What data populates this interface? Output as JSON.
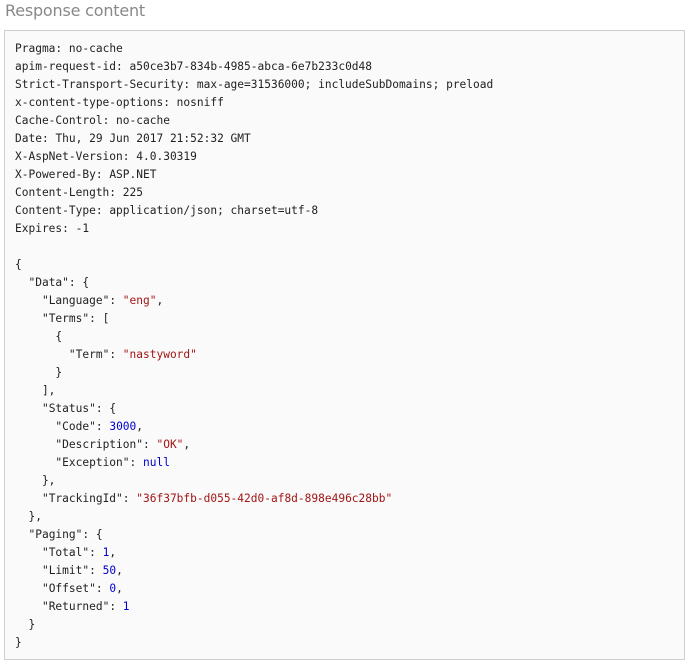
{
  "section": {
    "title": "Response content"
  },
  "response": {
    "headers": [
      {
        "name": "Pragma",
        "value": "no-cache"
      },
      {
        "name": "apim-request-id",
        "value": "a50ce3b7-834b-4985-abca-6e7b233c0d48"
      },
      {
        "name": "Strict-Transport-Security",
        "value": "max-age=31536000; includeSubDomains; preload"
      },
      {
        "name": "x-content-type-options",
        "value": "nosniff"
      },
      {
        "name": "Cache-Control",
        "value": "no-cache"
      },
      {
        "name": "Date",
        "value": "Thu, 29 Jun 2017 21:52:32 GMT"
      },
      {
        "name": "X-AspNet-Version",
        "value": "4.0.30319"
      },
      {
        "name": "X-Powered-By",
        "value": "ASP.NET"
      },
      {
        "name": "Content-Length",
        "value": "225"
      },
      {
        "name": "Content-Type",
        "value": "application/json; charset=utf-8"
      },
      {
        "name": "Expires",
        "value": "-1"
      }
    ],
    "body_lines": [
      [
        {
          "t": "p",
          "v": "{"
        }
      ],
      [
        {
          "t": "p",
          "v": "  "
        },
        {
          "t": "k",
          "v": "\"Data\""
        },
        {
          "t": "p",
          "v": ": {"
        }
      ],
      [
        {
          "t": "p",
          "v": "    "
        },
        {
          "t": "k",
          "v": "\"Language\""
        },
        {
          "t": "p",
          "v": ": "
        },
        {
          "t": "s",
          "v": "\"eng\""
        },
        {
          "t": "p",
          "v": ","
        }
      ],
      [
        {
          "t": "p",
          "v": "    "
        },
        {
          "t": "k",
          "v": "\"Terms\""
        },
        {
          "t": "p",
          "v": ": ["
        }
      ],
      [
        {
          "t": "p",
          "v": "      {"
        }
      ],
      [
        {
          "t": "p",
          "v": "        "
        },
        {
          "t": "k",
          "v": "\"Term\""
        },
        {
          "t": "p",
          "v": ": "
        },
        {
          "t": "s",
          "v": "\"nastyword\""
        }
      ],
      [
        {
          "t": "p",
          "v": "      }"
        }
      ],
      [
        {
          "t": "p",
          "v": "    ],"
        }
      ],
      [
        {
          "t": "p",
          "v": "    "
        },
        {
          "t": "k",
          "v": "\"Status\""
        },
        {
          "t": "p",
          "v": ": {"
        }
      ],
      [
        {
          "t": "p",
          "v": "      "
        },
        {
          "t": "k",
          "v": "\"Code\""
        },
        {
          "t": "p",
          "v": ": "
        },
        {
          "t": "n",
          "v": "3000"
        },
        {
          "t": "p",
          "v": ","
        }
      ],
      [
        {
          "t": "p",
          "v": "      "
        },
        {
          "t": "k",
          "v": "\"Description\""
        },
        {
          "t": "p",
          "v": ": "
        },
        {
          "t": "s",
          "v": "\"OK\""
        },
        {
          "t": "p",
          "v": ","
        }
      ],
      [
        {
          "t": "p",
          "v": "      "
        },
        {
          "t": "k",
          "v": "\"Exception\""
        },
        {
          "t": "p",
          "v": ": "
        },
        {
          "t": "nl",
          "v": "null"
        }
      ],
      [
        {
          "t": "p",
          "v": "    },"
        }
      ],
      [
        {
          "t": "p",
          "v": "    "
        },
        {
          "t": "k",
          "v": "\"TrackingId\""
        },
        {
          "t": "p",
          "v": ": "
        },
        {
          "t": "s",
          "v": "\"36f37bfb-d055-42d0-af8d-898e496c28bb\""
        }
      ],
      [
        {
          "t": "p",
          "v": "  },"
        }
      ],
      [
        {
          "t": "p",
          "v": "  "
        },
        {
          "t": "k",
          "v": "\"Paging\""
        },
        {
          "t": "p",
          "v": ": {"
        }
      ],
      [
        {
          "t": "p",
          "v": "    "
        },
        {
          "t": "k",
          "v": "\"Total\""
        },
        {
          "t": "p",
          "v": ": "
        },
        {
          "t": "n",
          "v": "1"
        },
        {
          "t": "p",
          "v": ","
        }
      ],
      [
        {
          "t": "p",
          "v": "    "
        },
        {
          "t": "k",
          "v": "\"Limit\""
        },
        {
          "t": "p",
          "v": ": "
        },
        {
          "t": "n",
          "v": "50"
        },
        {
          "t": "p",
          "v": ","
        }
      ],
      [
        {
          "t": "p",
          "v": "    "
        },
        {
          "t": "k",
          "v": "\"Offset\""
        },
        {
          "t": "p",
          "v": ": "
        },
        {
          "t": "n",
          "v": "0"
        },
        {
          "t": "p",
          "v": ","
        }
      ],
      [
        {
          "t": "p",
          "v": "    "
        },
        {
          "t": "k",
          "v": "\"Returned\""
        },
        {
          "t": "p",
          "v": ": "
        },
        {
          "t": "n",
          "v": "1"
        }
      ],
      [
        {
          "t": "p",
          "v": "  }"
        }
      ],
      [
        {
          "t": "p",
          "v": "}"
        }
      ]
    ]
  },
  "colors": {
    "title": "#888888",
    "panel_border": "#cfcfcf",
    "panel_background": "#fafafa",
    "text": "#222222",
    "string": "#a31515",
    "number": "#0000cc",
    "literal": "#0000cc"
  }
}
